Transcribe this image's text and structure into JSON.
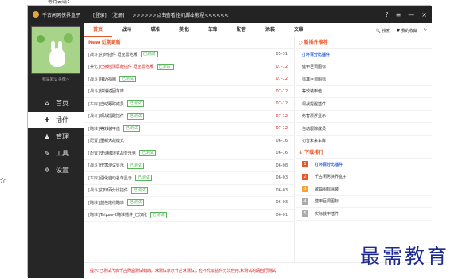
{
  "top_strip": "等待云端：",
  "side_char": "介",
  "titlebar": {
    "app_name": "千古闲男侠界盒子",
    "login": "[登录]",
    "register": "[注册]",
    "marquee": ">>>>>>点击查看挂机脚本教程<<<<<<",
    "help": "?",
    "menu": "≡",
    "minimize": "—",
    "close": "×"
  },
  "sidebar": {
    "avatar_caption": "我是默认头像~",
    "items": [
      {
        "label": "首页",
        "icon": "home-icon",
        "glyph": "⌂"
      },
      {
        "label": "插件",
        "icon": "puzzle-icon",
        "glyph": "✚"
      },
      {
        "label": "管理",
        "icon": "user-manage-icon",
        "glyph": "♟"
      },
      {
        "label": "工具",
        "icon": "wrench-icon",
        "glyph": "✎"
      },
      {
        "label": "设置",
        "icon": "gear-icon",
        "glyph": "✲"
      }
    ]
  },
  "tabs": [
    "首页",
    "战斗",
    "瞄准",
    "美化",
    "车库",
    "配音",
    "涂装",
    "文章"
  ],
  "tab_tools": {
    "search": "🔍 搜索",
    "collection": "♥ 我的收藏",
    "refresh": "↻"
  },
  "recent": {
    "title": "New 近期更新",
    "rows": [
      {
        "cat": "[战斗]",
        "name": "打坏插件 坦克雷地版",
        "red": false,
        "badge": "已测试",
        "date": "05-31",
        "date_red": false
      },
      {
        "cat": "[美化]",
        "name": "已被检测屏蔽插件 坦克雷地版",
        "red": true,
        "badge": "已测试",
        "date": "07-12",
        "date_red": true
      },
      {
        "cat": "[战斗]",
        "name": "接近视图",
        "red": false,
        "badge": "已测试",
        "date": "07-12",
        "date_red": true
      },
      {
        "cat": "[战斗]",
        "name": "快速返回车库",
        "red": false,
        "badge": "",
        "date": "07-12",
        "date_red": true
      },
      {
        "cat": "[车库]",
        "name": "自动跟踪成员",
        "red": false,
        "badge": "已测试",
        "date": "07-12",
        "date_red": true
      },
      {
        "cat": "[战斗]",
        "name": "现战提醒插件",
        "red": false,
        "badge": "已测试",
        "date": "07-12",
        "date_red": true
      },
      {
        "cat": "[瞄准]",
        "name": "等效装甲值",
        "red": false,
        "badge": "已测试",
        "date": "07-12",
        "date_red": true
      },
      {
        "cat": "[配置]",
        "name": "重新大战模式",
        "red": false,
        "badge": "",
        "date": "06-16",
        "date_red": false
      },
      {
        "cat": "[配置]",
        "name": "史诗级坦克战音乐包",
        "red": false,
        "badge": "已测试",
        "date": "06-16",
        "date_red": false
      },
      {
        "cat": "[战斗]",
        "name": "伤害测试显示",
        "red": false,
        "badge": "已测试",
        "date": "06-08",
        "date_red": false
      },
      {
        "cat": "[车库]",
        "name": "强化自动名单显示",
        "red": false,
        "badge": "已测试",
        "date": "06-03",
        "date_red": false
      },
      {
        "cat": "[战斗]",
        "name": "打环百分比插件",
        "red": false,
        "badge": "已测试",
        "date": "06-03",
        "date_red": false
      },
      {
        "cat": "[瞄准]",
        "name": "蓝色炮线瞄准",
        "red": false,
        "badge": "已测试",
        "date": "06-03",
        "date_red": false
      },
      {
        "cat": "[瞄准]",
        "name": "Taipan-2瞄准插件_已汉化",
        "red": false,
        "badge": "已测试",
        "date": "06-01",
        "date_red": false
      }
    ]
  },
  "recommend": {
    "title": "◇ 新插件推荐",
    "items": [
      {
        "name": "打环百分比插件",
        "blue": true
      },
      {
        "name": "健甲巨调图标",
        "blue": false
      },
      {
        "name": "标准巨调图标",
        "blue": false
      },
      {
        "name": "等效装甲值",
        "blue": false
      },
      {
        "name": "现战提醒插件",
        "blue": false
      },
      {
        "name": "伤害漂浮显示",
        "blue": false
      },
      {
        "name": "自动跟踪成员",
        "blue": false
      },
      {
        "name": "初音未来车库",
        "blue": false
      }
    ]
  },
  "ranking": {
    "title": "↓ 下载排行",
    "items": [
      {
        "num": "1",
        "name": "打环百分比插件",
        "color": "#e8572a",
        "blue": true
      },
      {
        "num": "2",
        "name": "千古闲男侠界盒子",
        "color": "#e8572a",
        "blue": false
      },
      {
        "num": "3",
        "name": "歌曲图标涂装",
        "color": "#f2a33a",
        "blue": false
      },
      {
        "num": "4",
        "name": "健甲巨调图标",
        "color": "#aaaaaa",
        "blue": false
      },
      {
        "num": "5",
        "name": "实际装甲插件",
        "color": "#aaaaaa",
        "blue": false
      }
    ]
  },
  "footer": "提示:已测试代表千古界盒测试有效，未测试表示千古未测试，但不代表插件无法使用,未测试的请自行测试",
  "watermark": "最需教育"
}
